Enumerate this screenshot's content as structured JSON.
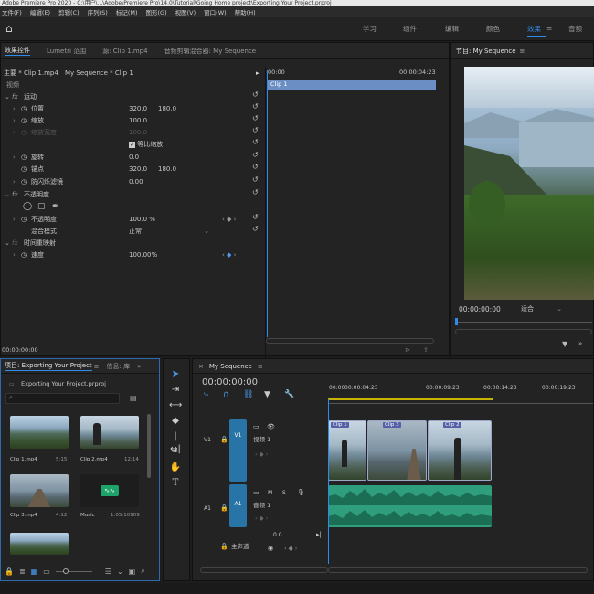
{
  "window_title": "Adobe Premiere Pro 2020 - C:\\用户\\...\\Adobe\\Premiere Pro\\14.0\\Tutorial\\Going Home project\\Exporting Your Project.prproj",
  "menu": [
    "文件(F)",
    "编辑(E)",
    "剪辑(C)",
    "序列(S)",
    "标记(M)",
    "图形(G)",
    "视图(V)",
    "窗口(W)",
    "帮助(H)"
  ],
  "workspaces": {
    "learn": "学习",
    "assembly": "组件",
    "editing": "编辑",
    "color": "颜色",
    "effects": "效果",
    "audio": "音频"
  },
  "effect_controls": {
    "tabs": [
      "效果控件",
      "Lumetri 范围",
      "源: Clip 1.mp4",
      "音频剪辑混合器: My Sequence"
    ],
    "master": "主要 * Clip 1.mp4",
    "sequence_clip": "My Sequence * Clip 1",
    "video_label": "视频",
    "time_start": "00:00",
    "time_end": "00:00:04:23",
    "clip_bar": "Clip 1",
    "motion": "运动",
    "position": "位置",
    "position_x": "320.0",
    "position_y": "180.0",
    "scale": "缩放",
    "scale_val": "100.0",
    "scale_width": "缩放宽度",
    "scale_width_val": "100.0",
    "uniform_scale": "等比缩放",
    "rotation": "旋转",
    "rotation_val": "0.0",
    "anchor": "锚点",
    "anchor_x": "320.0",
    "anchor_y": "180.0",
    "antiflicker": "防闪烁滤镜",
    "antiflicker_val": "0.00",
    "opacity_group": "不透明度",
    "opacity": "不透明度",
    "opacity_val": "100.0 %",
    "blend_mode": "混合模式",
    "blend_val": "正常",
    "time_remap": "时间重映射",
    "speed": "速度",
    "speed_val": "100.00%",
    "bottom_timecode": "00:00:00:00"
  },
  "program": {
    "tab": "节目: My Sequence",
    "timecode": "00:00:00:00",
    "fit": "适合"
  },
  "project": {
    "tabs": [
      "项目: Exporting Your Project",
      "信息: 库"
    ],
    "file": "Exporting Your Project.prproj",
    "items": [
      {
        "name": "Clip 1.mp4",
        "dur": "5:15"
      },
      {
        "name": "Clip 2.mp4",
        "dur": "12:14"
      },
      {
        "name": "Clip 3.mp4",
        "dur": "4:12"
      },
      {
        "name": "Music",
        "dur": "1:05:10909"
      }
    ]
  },
  "timeline": {
    "tab": "My Sequence",
    "timecode": "00:00:00:00",
    "ruler": [
      "00:00",
      "00:00:04:23",
      "00:00:09:23",
      "00:00:14:23",
      "00:00:19:23"
    ],
    "v1": "V1",
    "a1": "A1",
    "video_track": "视频 1",
    "audio_track": "音频 1",
    "master": "主声道",
    "master_val": "0.0",
    "clips": [
      "Clip 1",
      "Clip 3",
      "Clip 2"
    ]
  }
}
